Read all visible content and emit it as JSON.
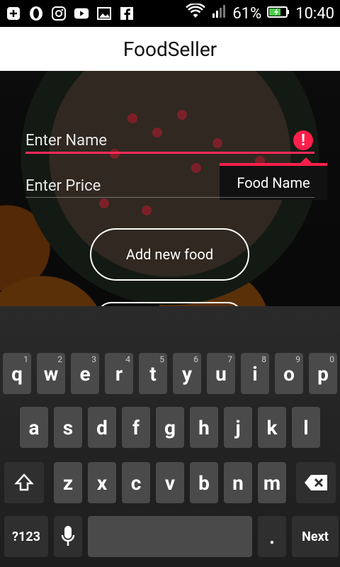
{
  "status_bar": {
    "battery_percent": "61%",
    "time": "10:40",
    "left_icons": [
      "add-icon",
      "opera-icon",
      "instagram-icon",
      "youtube-icon",
      "gallery-icon",
      "facebook-icon"
    ],
    "right_icons": [
      "wifi-icon",
      "signal-icon",
      "battery-icon"
    ]
  },
  "app_bar": {
    "title": "FoodSeller"
  },
  "form": {
    "name_placeholder": "Enter Name",
    "price_placeholder": "Enter Price",
    "error_tooltip": "Food Name",
    "add_button_label": "Add new food"
  },
  "keyboard": {
    "row1": [
      {
        "key": "q",
        "hint": "1"
      },
      {
        "key": "w",
        "hint": "2"
      },
      {
        "key": "e",
        "hint": "3"
      },
      {
        "key": "r",
        "hint": "4"
      },
      {
        "key": "t",
        "hint": "5"
      },
      {
        "key": "y",
        "hint": "6"
      },
      {
        "key": "u",
        "hint": "7"
      },
      {
        "key": "i",
        "hint": "8"
      },
      {
        "key": "o",
        "hint": "9"
      },
      {
        "key": "p",
        "hint": "0"
      }
    ],
    "row2": [
      "a",
      "s",
      "d",
      "f",
      "g",
      "h",
      "j",
      "k",
      "l"
    ],
    "row3": [
      "z",
      "x",
      "c",
      "v",
      "b",
      "n",
      "m"
    ],
    "sym_label": "?123",
    "period_label": ".",
    "next_label": "Next"
  },
  "colors": {
    "error": "#ff1f4a",
    "appbar_bg": "#ffffff"
  }
}
